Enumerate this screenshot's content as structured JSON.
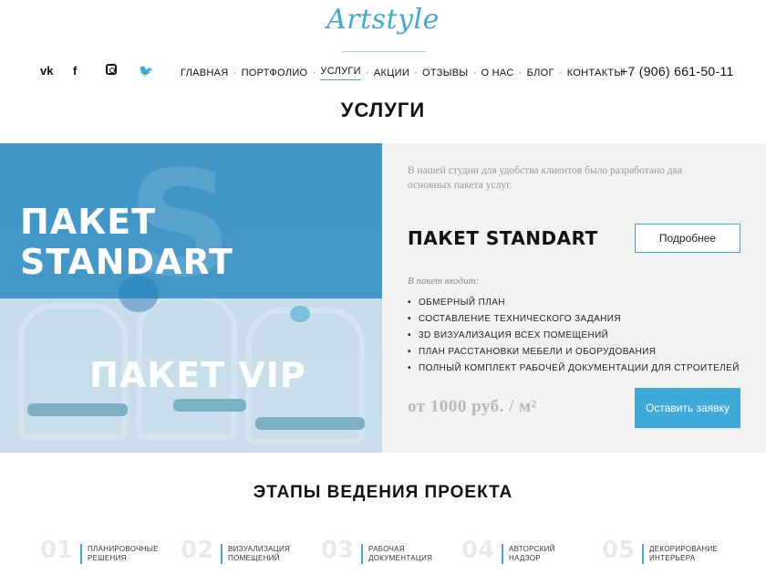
{
  "brand": {
    "logo": "Artstyle"
  },
  "social": [
    {
      "name": "vk-icon",
      "glyph": "vk"
    },
    {
      "name": "facebook-icon",
      "glyph": "f"
    },
    {
      "name": "instagram-icon",
      "glyph": ""
    },
    {
      "name": "twitter-icon",
      "glyph": "🐦"
    }
  ],
  "nav": {
    "items": [
      "ГЛАВНАЯ",
      "ПОРТФОЛИО",
      "УСЛУГИ",
      "АКЦИИ",
      "ОТЗЫВЫ",
      "О НАС",
      "БЛОГ",
      "КОНТАКТЫ"
    ],
    "active": "УСЛУГИ",
    "separator": "·"
  },
  "phone": "+7 (906) 661-50-11",
  "page_title": "УСЛУГИ",
  "hero": {
    "package_standart": "ПАКЕТ STANDART",
    "package_vip": "ПАКЕТ VIP"
  },
  "panel": {
    "intro": "В нашей студии для удобства клиентов было разработано два основных пакета услуг.",
    "title": "ПАКЕТ STANDART",
    "more_button": "Подробнее",
    "includes_label": "В пакет входит:",
    "features": [
      "ОБМЕРНЫЙ ПЛАН",
      "СОСТАВЛЕНИЕ ТЕХНИЧЕСКОГО ЗАДАНИЯ",
      "3D ВИЗУАЛИЗАЦИЯ ВСЕХ ПОМЕЩЕНИЙ",
      "ПЛАН РАССТАНОВКИ МЕБЕЛИ И ОБОРУДОВАНИЯ",
      "ПОЛНЫЙ КОМПЛЕКТ РАБОЧЕЙ ДОКУМЕНТАЦИИ ДЛЯ СТРОИТЕЛЕЙ"
    ],
    "bullet": "•",
    "price": "от 1000 руб. / м²",
    "order_button": "Оставить заявку"
  },
  "stages": {
    "title": "ЭТАПЫ ВЕДЕНИЯ ПРОЕКТА",
    "items": [
      {
        "num": "01",
        "label": "ПЛАНИРОВОЧНЫЕ\nРЕШЕНИЯ"
      },
      {
        "num": "02",
        "label": "ВИЗУАЛИЗАЦИЯ\nПОМЕЩЕНИЙ"
      },
      {
        "num": "03",
        "label": "РАБОЧАЯ\nДОКУМЕНТАЦИЯ"
      },
      {
        "num": "04",
        "label": "АВТОРСКИЙ\nНАДЗОР"
      },
      {
        "num": "05",
        "label": "ДЕКОРИРОВАНИЕ\nИНТЕРЬЕРА"
      }
    ]
  },
  "colors": {
    "accent": "#3fa9d9",
    "panel_bg": "#f2f2f2",
    "price": "#b8b8b8"
  }
}
